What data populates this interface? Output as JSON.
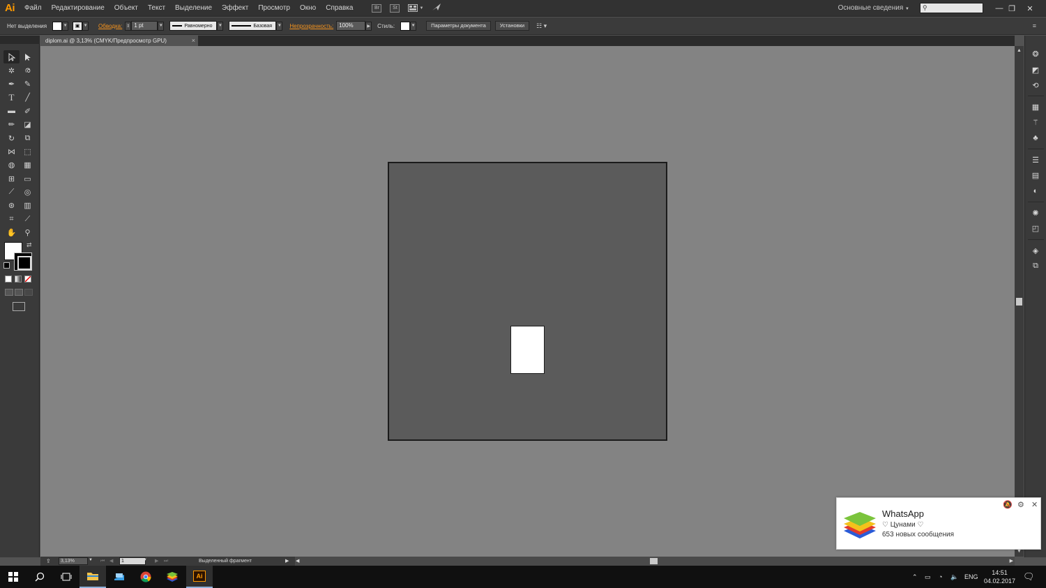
{
  "app": {
    "logo": "Ai",
    "menu": [
      "Файл",
      "Редактирование",
      "Объект",
      "Текст",
      "Выделение",
      "Эффект",
      "Просмотр",
      "Окно",
      "Справка"
    ],
    "bridge_label": "Br",
    "stock_label": "St",
    "workspace": "Основные сведения",
    "window_controls": [
      "—",
      "❐",
      "✕"
    ]
  },
  "controlbar": {
    "selection_label": "Нет выделения",
    "stroke_label": "Обводка:",
    "stroke_weight": "1 pt",
    "profile_label": "Равномерно",
    "brush_label": "Базовая",
    "opacity_label": "Непрозрачность:",
    "opacity_value": "100%",
    "style_label": "Стиль:",
    "doc_setup_button": "Параметры документа",
    "prefs_button": "Установки"
  },
  "document": {
    "tab_title": "diplom.ai @ 3,13% (CMYK/Предпросмотр GPU)",
    "tab_close": "×"
  },
  "statusbar": {
    "zoom": "3,13%",
    "page": "1",
    "tool_status": "Выделенный фрагмент"
  },
  "notification": {
    "title": "WhatsApp",
    "subtitle": "♡ Цунами ♡",
    "body": "653 новых сообщения"
  },
  "taskbar": {
    "lang": "ENG",
    "time": "14:51",
    "date": "04.02.2017",
    "ai_label": "Ai"
  },
  "colors": {
    "accent_orange": "#f7941d",
    "canvas_gray": "#838383",
    "artboard_gray": "#5b5b5b"
  }
}
